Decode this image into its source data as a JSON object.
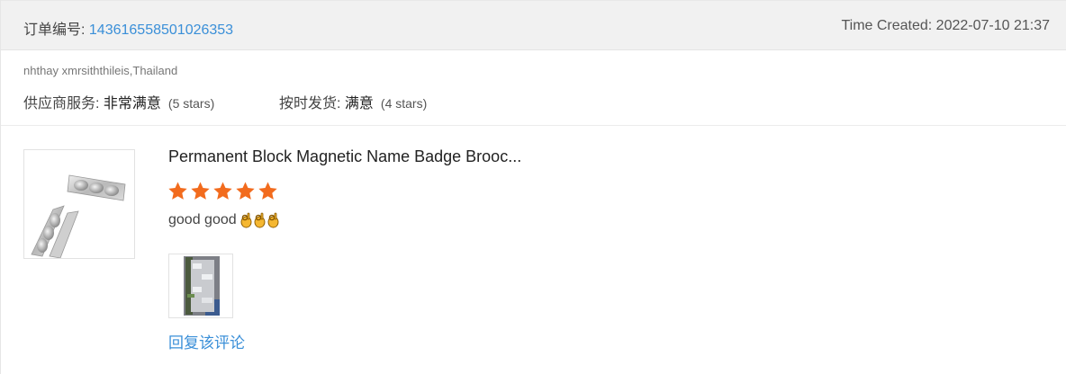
{
  "header": {
    "order_label": "订单编号: ",
    "order_id": "143616558501026353",
    "time_created": "Time Created: 2022-07-10 21:37"
  },
  "buyer": {
    "name_location": "nhthay xmrsiththileis,Thailand"
  },
  "ratings": [
    {
      "label": "供应商服务: ",
      "level": "非常满意",
      "stars_text": "(5 stars)",
      "stars": 5
    },
    {
      "label": "按时发货: ",
      "level": "满意",
      "stars_text": "(4 stars)",
      "stars": 4
    }
  ],
  "product": {
    "title": "Permanent Block Magnetic Name Badge Brooc...",
    "thumbnail_icon": "magnetic-badge-image",
    "rating": 5,
    "star_color": "#f26b1d"
  },
  "review": {
    "text": "good good",
    "emoji": "ok-hand-emoji",
    "emoji_count": 3,
    "photo_icon": "review-photo"
  },
  "actions": {
    "reply_label": "回复该评论"
  },
  "colors": {
    "link": "#3a8fd8",
    "header_bg": "#f1f1f1",
    "star": "#f26b1d"
  }
}
